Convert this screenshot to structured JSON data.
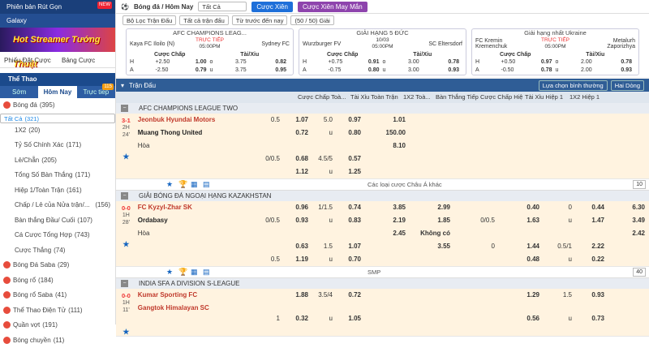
{
  "left": {
    "promo1": "Phiên bản Rút Gọn",
    "promo1_badge": "NEW",
    "promo2": "Galaxy",
    "banner": "Hot Streamer Tướng Thuật",
    "bet_tabs": [
      "Phiếu Đặt Cược",
      "Bảng Cược"
    ],
    "sport": "Thể Thao",
    "time_tabs": [
      "Sớm",
      "Hôm Nay",
      "Trực tiếp"
    ],
    "live_count": "115",
    "menu": [
      {
        "label": "Bóng đá",
        "count": "(395)",
        "top": true,
        "icon": true
      },
      {
        "label": "Tất Cả",
        "count": "(321)",
        "sel": true
      },
      {
        "label": "1X2",
        "count": "(20)"
      },
      {
        "label": "Tỷ Số Chính Xác",
        "count": "(171)"
      },
      {
        "label": "Lẻ/Chẵn",
        "count": "(205)"
      },
      {
        "label": "Tổng Số Bàn Thắng",
        "count": "(171)"
      },
      {
        "label": "Hiệp 1/Toàn Trận",
        "count": "(161)"
      },
      {
        "label": "Chấp / Lẻ của Nửa trận/...",
        "count": "(156)",
        "rcount": true
      },
      {
        "label": "Bàn thắng Đầu/ Cuối",
        "count": "(107)"
      },
      {
        "label": "Cá Cược Tổng Hợp",
        "count": "(743)"
      },
      {
        "label": "Cược Thắng",
        "count": "(74)"
      },
      {
        "label": "Bóng Đá Saba",
        "count": "(29)",
        "top": true,
        "icon": true
      },
      {
        "label": "Bóng rổ",
        "count": "(184)",
        "top": true,
        "icon": true
      },
      {
        "label": "Bóng rổ Saba",
        "count": "(41)",
        "top": true,
        "icon": true
      },
      {
        "label": "Thể Thao Điện Tử",
        "count": "(111)",
        "top": true,
        "icon": true
      },
      {
        "label": "Quần vợt",
        "count": "(191)",
        "top": true,
        "icon": true
      },
      {
        "label": "Bóng chuyền",
        "count": "(11)",
        "top": true,
        "icon": true
      }
    ]
  },
  "topbar": {
    "title": "Bóng đá / Hôm Nay",
    "select": "Tất Cả",
    "btn1": "Cược Xiên",
    "btn2": "Cược Xiên May Mắn"
  },
  "filters": {
    "f1": "Bộ Lọc Trận Đấu",
    "f2": "Tất cả trận đấu",
    "f3": "Từ trước đến nay",
    "f4": "(50 / 50) Giải"
  },
  "cards": [
    {
      "league": "AFC CHAMPIONS LEAG...",
      "home": "Kaya FC Iloilo (N)",
      "away": "Sydney FC",
      "status": "TRỰC TIẾP",
      "time": "05:00PM",
      "h1": "Cược Chấp",
      "h2": "Tài/Xỉu",
      "r1": [
        "H",
        "+2.50",
        "1.00",
        "o",
        "3.75",
        "0.82"
      ],
      "r2": [
        "A",
        "-2.50",
        "0.79",
        "u",
        "3.75",
        "0.95"
      ]
    },
    {
      "league": "GIẢI HẠNG 5 ĐỨC",
      "home": "Wurzburger FV",
      "away": "SC Eltersdorf",
      "status": "10/03",
      "time": "05:00PM",
      "h1": "Cược Chấp",
      "h2": "Tài/Xỉu",
      "r1": [
        "H",
        "+0.75",
        "0.91",
        "o",
        "3.00",
        "0.78"
      ],
      "r2": [
        "A",
        "-0.75",
        "0.80",
        "u",
        "3.00",
        "0.93"
      ]
    },
    {
      "league": "Giải hạng nhất Ukraine",
      "home": "FC Kremin Kremenchuk",
      "away": "Metalurh Zaporizhya",
      "status": "TRỰC TIẾP",
      "time": "05:00PM",
      "h1": "Cược Chấp",
      "h2": "Tài/Xỉu",
      "r1": [
        "H",
        "+0.50",
        "0.97",
        "o",
        "2.00",
        "0.78"
      ],
      "r2": [
        "A",
        "-0.50",
        "0.78",
        "u",
        "2.00",
        "0.93"
      ]
    }
  ],
  "section": {
    "title": "Trận Đấu",
    "sel1": "Lựa chọn bình thường",
    "sel2": "Hai Dòng"
  },
  "cols": [
    "Cược Chấp Toà...",
    "Tài Xỉu Toàn Trận",
    "1X2 Toà...",
    "Bàn Thắng Tiếp...",
    "Cược Chấp Hiệ...",
    "Tài Xỉu Hiệp 1",
    "1X2 Hiệp 1"
  ],
  "leagues": [
    {
      "name": "AFC CHAMPIONS LEAGUE TWO",
      "score": "3-1",
      "half": "2H",
      "min": "24'",
      "home": "Jeonbuk Hyundai Motors",
      "away": "Muang Thong United",
      "draw": "Hòa",
      "rows": [
        [
          "0.5",
          "1.07",
          "5.0",
          "0.97",
          "1.01",
          "",
          "",
          "",
          "",
          "",
          ""
        ],
        [
          "",
          "0.72",
          "u",
          "0.80",
          "150.00",
          "",
          "",
          "",
          "",
          "",
          ""
        ],
        [
          "",
          "",
          "",
          "",
          "8.10",
          "",
          "",
          "",
          "",
          "",
          ""
        ],
        [
          "0/0.5",
          "0.68",
          "4.5/5",
          "0.57",
          "",
          "",
          "",
          "",
          "",
          "",
          ""
        ],
        [
          "",
          "1.12",
          "u",
          "1.25",
          "",
          "",
          "",
          "",
          "",
          "",
          ""
        ]
      ],
      "more": "Các loại cược Châu Á khác",
      "num": "10"
    },
    {
      "name": "GIẢI BÓNG ĐÁ NGOẠI HẠNG KAZAKHSTAN",
      "score": "0-0",
      "half": "1H",
      "min": "28'",
      "home": "FC Kyzyl-Zhar SK",
      "away": "Ordabasy",
      "draw": "Hòa",
      "rows": [
        [
          "",
          "0.96",
          "1/1.5",
          "0.74",
          "3.85",
          "2.99",
          "",
          "0.40",
          "0",
          "0.44",
          "6.30"
        ],
        [
          "0/0.5",
          "0.93",
          "u",
          "0.83",
          "2.19",
          "1.85",
          "0/0.5",
          "1.63",
          "u",
          "1.47",
          "3.49"
        ],
        [
          "",
          "",
          "",
          "",
          "2.45",
          "Không có 3.55",
          "",
          "",
          "",
          "",
          "2.42"
        ],
        [
          "",
          "0.63",
          "1.5",
          "1.07",
          "",
          "",
          "0",
          "1.44",
          "0.5/1",
          "2.22",
          ""
        ],
        [
          "0.5",
          "1.19",
          "u",
          "0.70",
          "",
          "",
          "",
          "0.48",
          "u",
          "0.22",
          ""
        ]
      ],
      "more": "SMP",
      "num": "40"
    },
    {
      "name": "INDIA SFA A DIVISION S-LEAGUE",
      "score": "0-0",
      "half": "1H",
      "min": "11'",
      "home": "Kumar Sporting FC",
      "away": "Gangtok Himalayan SC",
      "draw": "",
      "rows": [
        [
          "",
          "1.88",
          "3.5/4",
          "0.72",
          "",
          "",
          "",
          "1.29",
          "1.5",
          "0.93",
          ""
        ],
        [
          "1",
          "0.32",
          "u",
          "1.05",
          "",
          "",
          "",
          "0.56",
          "u",
          "0.73",
          ""
        ]
      ]
    }
  ]
}
